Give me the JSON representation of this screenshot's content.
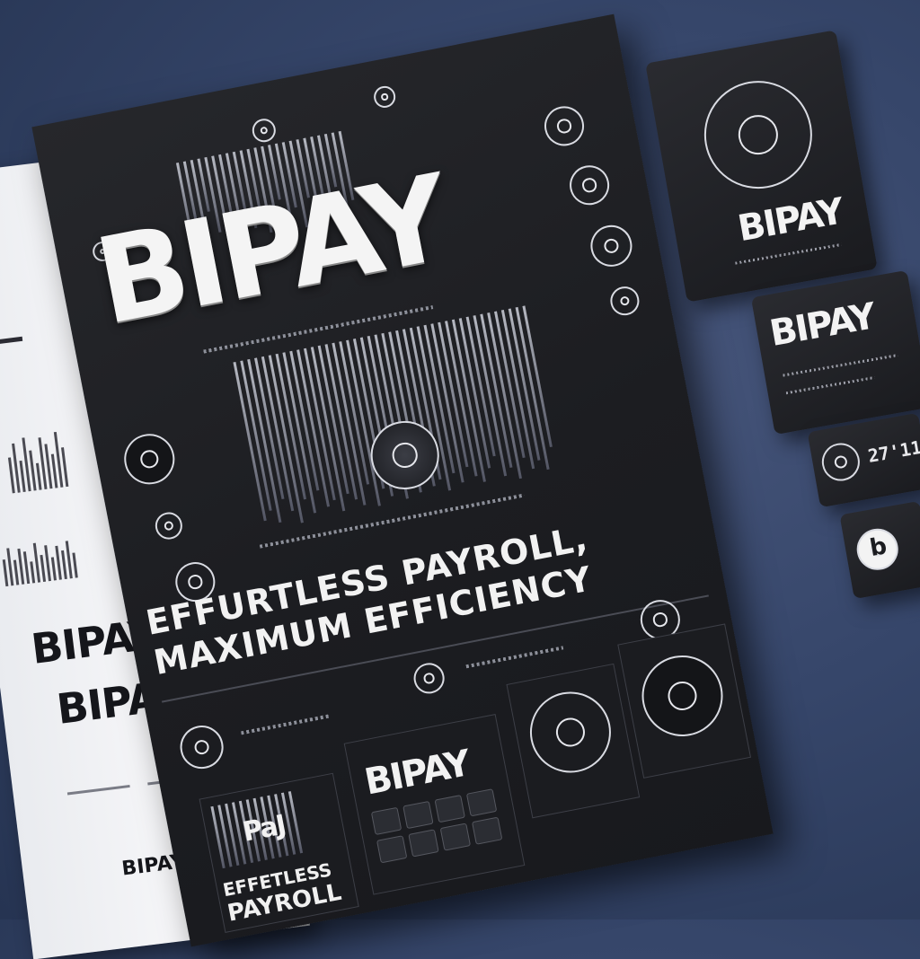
{
  "brand": {
    "name": "BIPAY",
    "left_sheet_logos": [
      "BIPAY",
      "BIPAY",
      "BIPAY"
    ]
  },
  "poster": {
    "headline": "BIPAY",
    "tagline_line1": "EFFURTLESS PAYROLL,",
    "tagline_line2": "MAXIMUM EFFICIENCY",
    "panel_small_brand": "PaJ",
    "panel_text_line1": "EFFETLESS",
    "panel_text_line2": "PAYROLL",
    "panel_brand": "BIPAY"
  },
  "cards": {
    "card1_brand": "BIPAY",
    "card2_brand": "BIPAY",
    "card3_number": "27'11",
    "card4_logo": "b"
  },
  "colors": {
    "background": "#36466a",
    "poster": "#1c1d21",
    "text": "#f4f4f4",
    "sheet": "#f2f3f5"
  }
}
